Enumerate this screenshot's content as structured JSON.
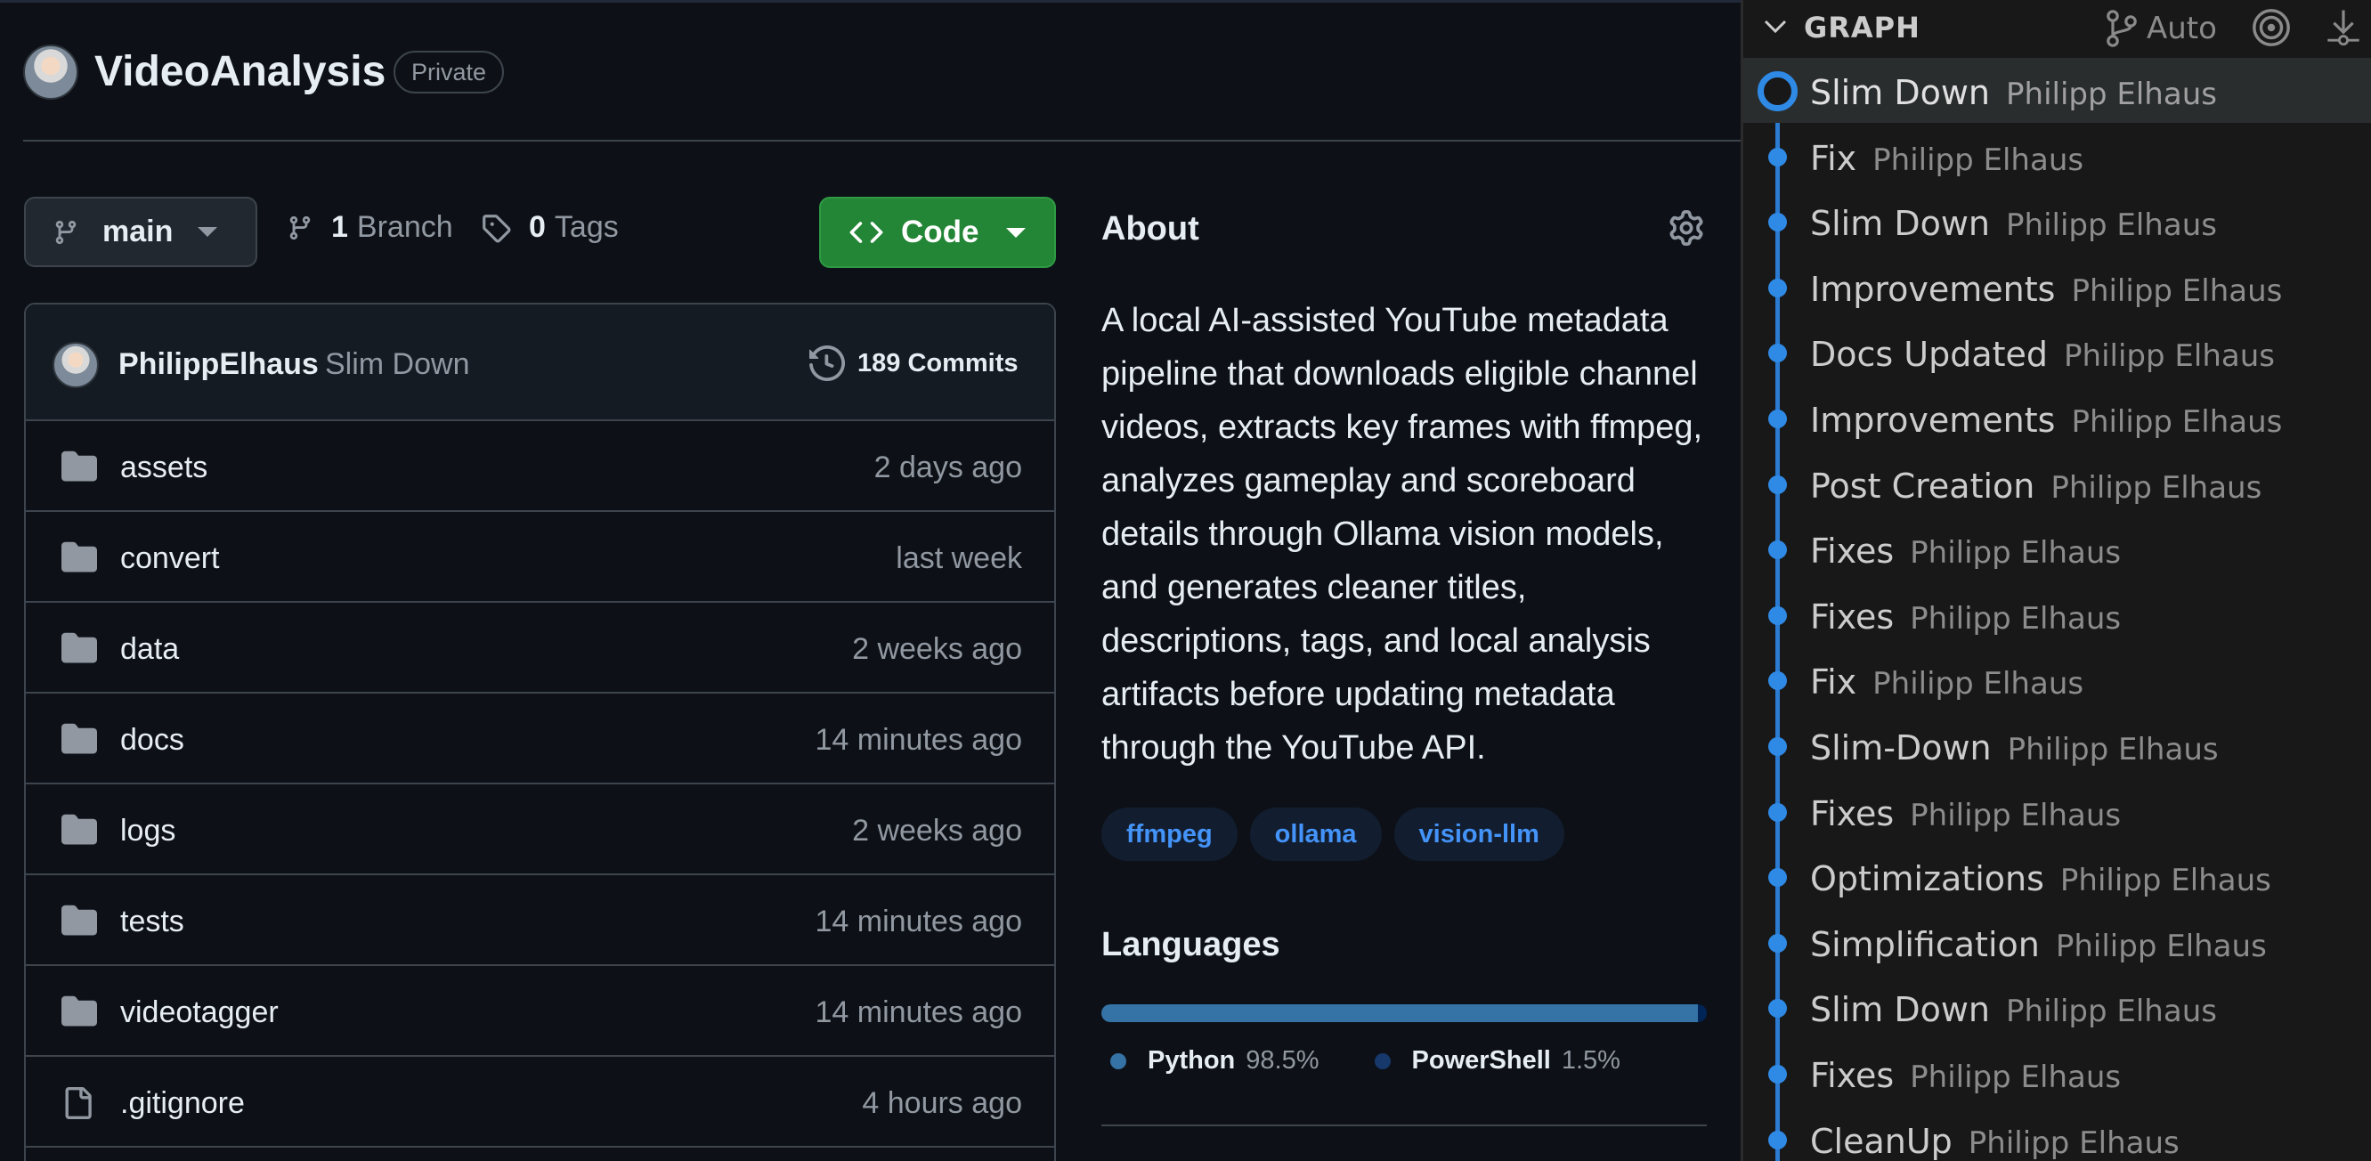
{
  "repo": {
    "name": "VideoAnalysis",
    "visibility": "Private"
  },
  "toolbar": {
    "branch": "main",
    "branch_count": "1",
    "branch_label": "Branch",
    "tag_count": "0",
    "tag_label": "Tags",
    "code_label": "Code"
  },
  "latest_commit": {
    "author": "PhilippElhaus",
    "message": "Slim Down",
    "commit_count": "189 Commits"
  },
  "files": [
    {
      "name": "assets",
      "type": "folder",
      "time": "2 days ago"
    },
    {
      "name": "convert",
      "type": "folder",
      "time": "last week"
    },
    {
      "name": "data",
      "type": "folder",
      "time": "2 weeks ago"
    },
    {
      "name": "docs",
      "type": "folder",
      "time": "14 minutes ago"
    },
    {
      "name": "logs",
      "type": "folder",
      "time": "2 weeks ago"
    },
    {
      "name": "tests",
      "type": "folder",
      "time": "14 minutes ago"
    },
    {
      "name": "videotagger",
      "type": "folder",
      "time": "14 minutes ago"
    },
    {
      "name": ".gitignore",
      "type": "file",
      "time": "4 hours ago"
    }
  ],
  "about": {
    "title": "About",
    "description": "A local AI-assisted YouTube metadata pipeline that downloads eligible channel videos, extracts key frames with ffmpeg, analyzes gameplay and scoreboard details through Ollama vision models, and generates cleaner titles, descriptions, tags, and local analysis artifacts before updating metadata through the YouTube API.",
    "topics": [
      "ffmpeg",
      "ollama",
      "vision-llm"
    ]
  },
  "languages": {
    "title": "Languages",
    "items": [
      {
        "name": "Python",
        "percent_label": "98.5%",
        "percent": 98.5,
        "color": "#3572a5"
      },
      {
        "name": "PowerShell",
        "percent_label": "1.5%",
        "percent": 1.5,
        "color": "#012456"
      }
    ]
  },
  "graph": {
    "title": "GRAPH",
    "auto_label": "Auto",
    "commits": [
      {
        "message": "Slim Down",
        "author": "Philipp Elhaus"
      },
      {
        "message": "Fix",
        "author": "Philipp Elhaus"
      },
      {
        "message": "Slim Down",
        "author": "Philipp Elhaus"
      },
      {
        "message": "Improvements",
        "author": "Philipp Elhaus"
      },
      {
        "message": "Docs Updated",
        "author": "Philipp Elhaus"
      },
      {
        "message": "Improvements",
        "author": "Philipp Elhaus"
      },
      {
        "message": "Post Creation",
        "author": "Philipp Elhaus"
      },
      {
        "message": "Fixes",
        "author": "Philipp Elhaus"
      },
      {
        "message": "Fixes",
        "author": "Philipp Elhaus"
      },
      {
        "message": "Fix",
        "author": "Philipp Elhaus"
      },
      {
        "message": "Slim-Down",
        "author": "Philipp Elhaus"
      },
      {
        "message": "Fixes",
        "author": "Philipp Elhaus"
      },
      {
        "message": "Optimizations",
        "author": "Philipp Elhaus"
      },
      {
        "message": "Simplification",
        "author": "Philipp Elhaus"
      },
      {
        "message": "Slim Down",
        "author": "Philipp Elhaus"
      },
      {
        "message": "Fixes",
        "author": "Philipp Elhaus"
      },
      {
        "message": "CleanUp",
        "author": "Philipp Elhaus"
      }
    ]
  },
  "colors": {
    "background": "#0d1117",
    "accent_green": "#238636",
    "link_blue": "#4493f8",
    "graph_blue": "#2f8ae6"
  }
}
